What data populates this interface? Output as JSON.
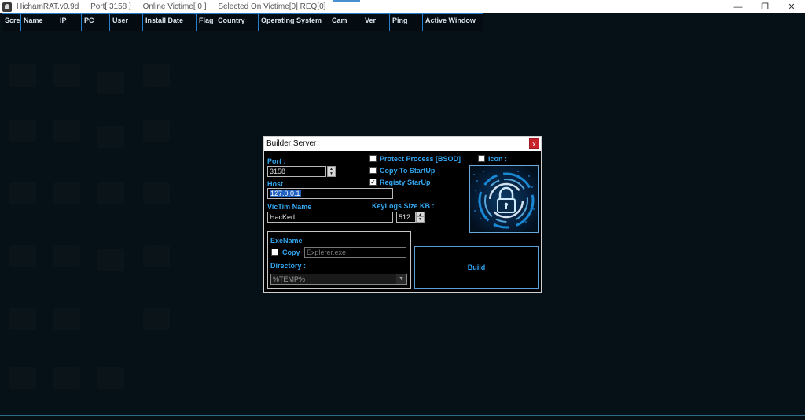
{
  "window": {
    "app_name": "HichamRAT.v0.9d",
    "port_status": "Port[ 3158 ]",
    "online_status": "Online Victime[ 0 ]",
    "selected_status": "Selected On Victime[0] REQ[0]",
    "controls": {
      "minimize": "—",
      "maximize": "❐",
      "close": "✕"
    }
  },
  "grid": {
    "columns": [
      "Scree",
      "Name",
      "IP",
      "PC",
      "User",
      "Install Date",
      "Flag",
      "Country",
      "Operating System",
      "Cam",
      "Ver",
      "Ping",
      "Active Window"
    ]
  },
  "builder": {
    "title": "Builder Server",
    "close": "x",
    "port_label": "Port :",
    "port_value": "3158",
    "host_label": "Host",
    "host_value": "127.0.0.1",
    "victim_name_label": "VicTim Name",
    "victim_name_value": "HacKed",
    "protect_process_label": "Protect Process [BSOD]",
    "copy_startup_label": "Copy To StartUp",
    "registry_startup_label": "Registy StarUp",
    "registry_checkmark": "✓",
    "keylogs_label": "KeyLogs Size KB :",
    "keylogs_value": "512",
    "icon_label": "Icon :",
    "exename_label": "ExeName",
    "copy_label": "Copy",
    "exename_value": "Explerer.exe",
    "directory_label": "Directory :",
    "directory_value": "%TEMP%",
    "build_label": "Build"
  },
  "colors": {
    "accent": "#32a6f0",
    "background": "#061017",
    "border": "#1f7fd0"
  }
}
